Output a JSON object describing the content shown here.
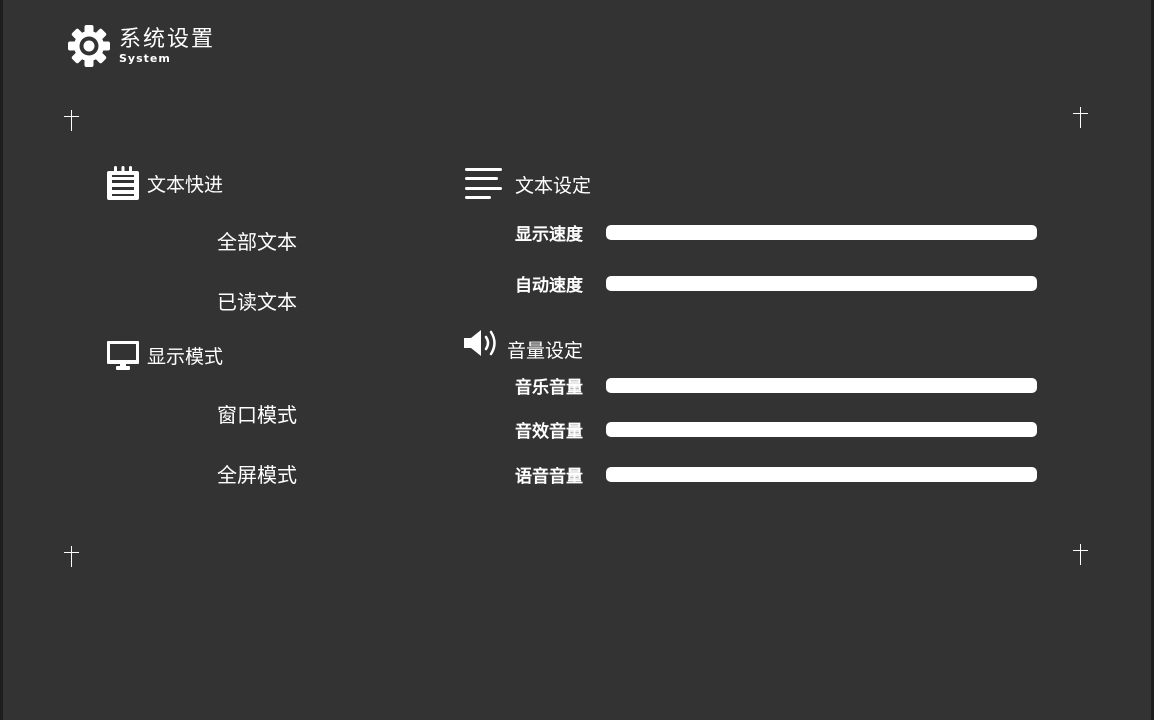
{
  "header": {
    "title": "系统设置",
    "subtitle": "System",
    "icon": "gear-icon"
  },
  "left_panel": {
    "text_skip": {
      "icon": "notepad-icon",
      "label": "文本快进",
      "items": [
        "全部文本",
        "已读文本"
      ]
    },
    "display_mode": {
      "icon": "monitor-icon",
      "label": "显示模式",
      "items": [
        "窗口模式",
        "全屏模式"
      ]
    }
  },
  "right_panel": {
    "text_settings": {
      "icon": "lines-icon",
      "label": "文本设定",
      "sliders": [
        {
          "label": "显示速度",
          "value": 1.0
        },
        {
          "label": "自动速度",
          "value": 1.0
        }
      ]
    },
    "volume_settings": {
      "icon": "speaker-icon",
      "label": "音量设定",
      "sliders": [
        {
          "label": "音乐音量",
          "value": 1.0
        },
        {
          "label": "音效音量",
          "value": 1.0
        },
        {
          "label": "语音音量",
          "value": 1.0
        }
      ]
    }
  },
  "colors": {
    "background": "#333333",
    "foreground": "#ffffff"
  }
}
